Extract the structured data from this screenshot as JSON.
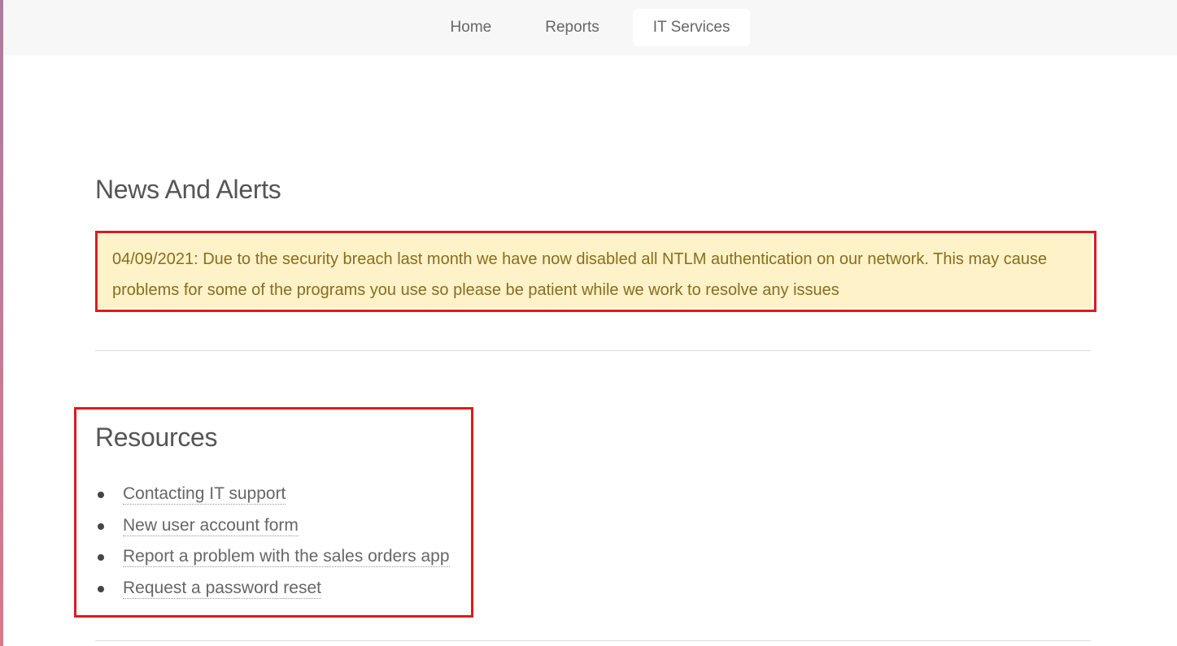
{
  "nav": {
    "items": [
      {
        "label": "Home",
        "active": false
      },
      {
        "label": "Reports",
        "active": false
      },
      {
        "label": "IT Services",
        "active": true
      }
    ]
  },
  "news": {
    "title": "News And Alerts",
    "alert_text": "04/09/2021: Due to the security breach last month we have now disabled all NTLM authentication on our network. This may cause problems for some of the programs you use so please be patient while we work to resolve any issues"
  },
  "resources": {
    "title": "Resources",
    "links": [
      {
        "label": "Contacting IT support"
      },
      {
        "label": "New user account form"
      },
      {
        "label": "Report a problem with the sales orders app"
      },
      {
        "label": "Request a password reset"
      }
    ]
  },
  "colors": {
    "alert_background": "#fdf2c8",
    "alert_text": "#8a6d1e",
    "highlight_outline": "#e01a1a",
    "nav_background": "#f7f7f7"
  }
}
